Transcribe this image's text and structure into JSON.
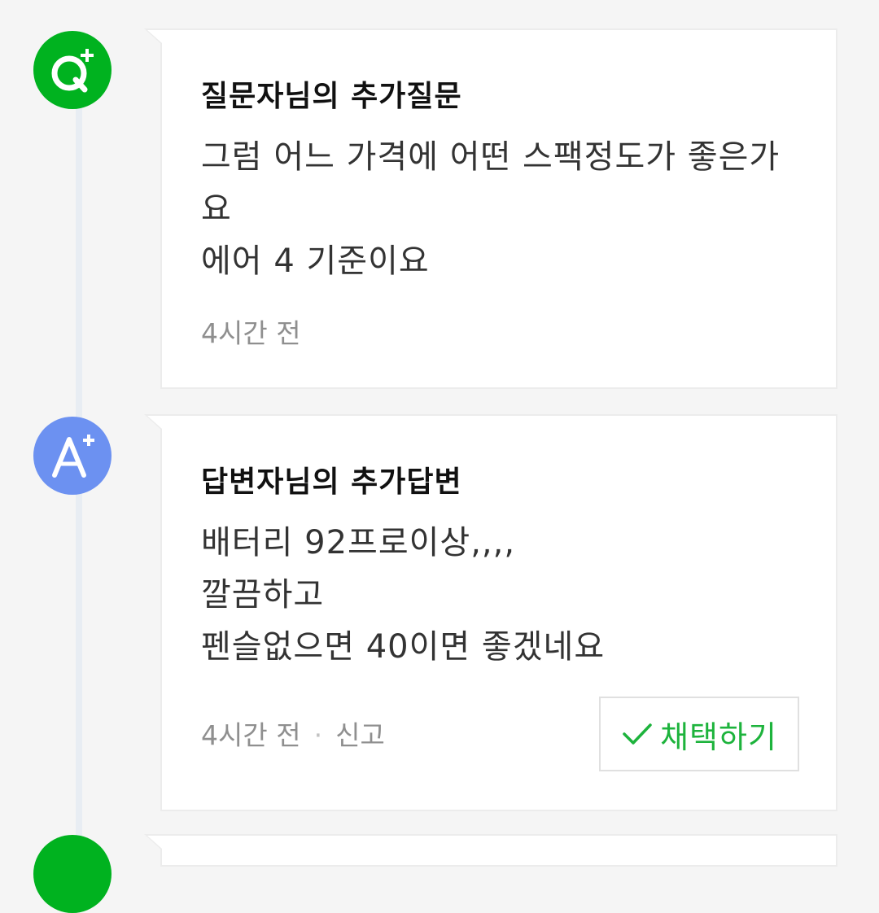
{
  "question": {
    "badge_icon": "q-plus-icon",
    "badge_color": "#00b21f",
    "title": "질문자님의 추가질문",
    "body_lines": [
      "그럼 어느 가격에 어떤 스팩정도가 좋은가",
      "요",
      "에어 4 기준이요"
    ],
    "time": "4시간 전"
  },
  "answer": {
    "badge_icon": "a-plus-icon",
    "badge_color": "#6c91f1",
    "title": "답변자님의 추가답변",
    "body_lines": [
      "배터리 92프로이상,,,,",
      "깔끔하고",
      "펜슬없으면 40이면 좋겠네요"
    ],
    "time": "4시간 전",
    "separator": "·",
    "report_label": "신고",
    "adopt_button_label": "채택하기",
    "adopt_color": "#1db33c"
  }
}
